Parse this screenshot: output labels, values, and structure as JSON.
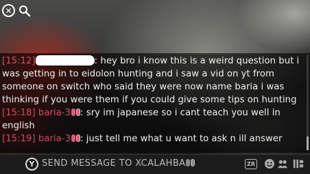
{
  "toolbar": {
    "close_icon": "close-icon",
    "search_icon": "search-icon"
  },
  "chat": {
    "messages": [
      {
        "time": "[15:12]",
        "sender": "",
        "sender_redacted": true,
        "text": "hey bro i know this is a weird question but i was getting in to eidolon hunting and i saw a vid on yt from someone on switch who said they were now name baria i was thinking if you were them if you could give some tips on hunting"
      },
      {
        "time": "[15:18]",
        "sender": "baria-3",
        "text": "sry im japanese so i cant teach you well in english"
      },
      {
        "time": "[15:19]",
        "sender": "baria-3",
        "text": "just tell me what u want to ask n ill answer"
      }
    ]
  },
  "input": {
    "button_glyph": "Y",
    "placeholder": "SEND MESSAGE TO XCALAHBA"
  },
  "bottom": {
    "zr_label": "ZR",
    "icons": [
      "emoji-icon",
      "group-icon",
      "settings-icon"
    ]
  },
  "colors": {
    "name": "#d24c63",
    "text": "#f2f2f2",
    "platform_badge": "#e05a7a"
  }
}
